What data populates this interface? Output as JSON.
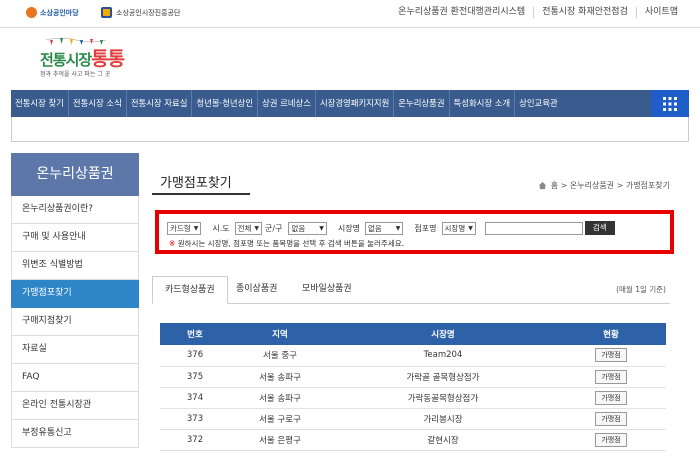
{
  "header": {
    "logo1": "소상공인마당",
    "logo2": "소상공인시장진흥공단",
    "links": [
      "온누리상품권 환전대행관리시스템",
      "전통시장 화재안전점검",
      "사이트맵"
    ]
  },
  "brand": {
    "name_a": "전통시장",
    "name_b": "통통",
    "tagline": "정과 추억을 사고 파는 그 곳"
  },
  "nav": [
    "전통시장 찾기",
    "전통시장 소식",
    "전통시장 자료실",
    "청년몰·청년상인",
    "상권 르네상스",
    "시장경영패키지지원",
    "온누리상품권",
    "특성화시장 소개",
    "상인교육관"
  ],
  "sidebar": {
    "title": "온누리상품권",
    "items": [
      "온누리상품권이란?",
      "구매 및 사용안내",
      "위변조 식별방법",
      "가맹점포찾기",
      "구매지점찾기",
      "자료실",
      "FAQ",
      "온라인 전통시장관",
      "부정유통신고"
    ],
    "active_index": 3
  },
  "main": {
    "title": "가맹점포찾기",
    "breadcrumb": "홈 > 온누리상품권 > 가맹점포찾기",
    "search": {
      "type_value": "카드형",
      "sido_label": "시.도",
      "sido_value": "전체",
      "gugun_label": "군/구",
      "gugun_value": "없음",
      "market_label": "시장명",
      "market_value": "없음",
      "store_label": "점포명",
      "store_value": "시장명",
      "button": "검색",
      "note_star": "※",
      "note": "원하시는 시장명, 점포명 또는 품목명을 선택 후 검색 버튼을 눌러주세요."
    },
    "tabs": [
      "카드형상품권",
      "종이상품권",
      "모바일상품권"
    ],
    "date_note": "(매월 1일 기준)",
    "table": {
      "headers": [
        "번호",
        "지역",
        "시장명",
        "현황"
      ],
      "rows": [
        {
          "no": "376",
          "region": "서울 중구",
          "market": "Team204",
          "status": "가맹점"
        },
        {
          "no": "375",
          "region": "서울 송파구",
          "market": "가락골 골목형상점가",
          "status": "가맹점"
        },
        {
          "no": "374",
          "region": "서울 송파구",
          "market": "가락동골목형상점가",
          "status": "가맹점"
        },
        {
          "no": "373",
          "region": "서울 구로구",
          "market": "가리봉시장",
          "status": "가맹점"
        },
        {
          "no": "372",
          "region": "서울 은평구",
          "market": "갈현시장",
          "status": "가맹점"
        }
      ]
    }
  },
  "colors": {
    "nav": "#3a5b8e",
    "active": "#2e86c9",
    "highlight": "#e60000",
    "table_head": "#2e62a8"
  }
}
